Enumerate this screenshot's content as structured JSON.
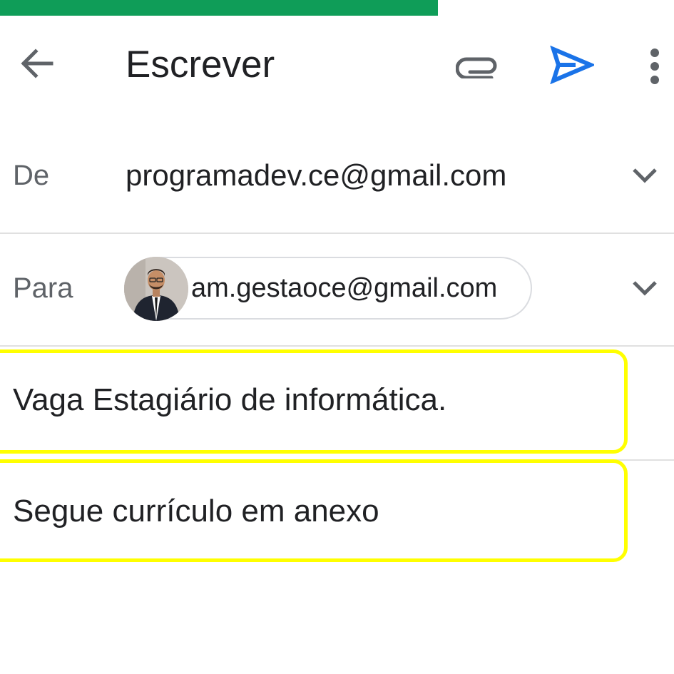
{
  "progress": {
    "fraction": 0.65,
    "color": "#0f9d58"
  },
  "appbar": {
    "title": "Escrever",
    "icons": {
      "back": "arrow-back-icon",
      "attach": "paperclip-icon",
      "send": "send-icon",
      "more": "more-vert-icon"
    },
    "send_color": "#1a73e8"
  },
  "from": {
    "label": "De",
    "value": "programadev.ce@gmail.com"
  },
  "to": {
    "label": "Para",
    "recipient": "am.gestaoce@gmail.com"
  },
  "subject": {
    "value": "Vaga Estagiário de informática."
  },
  "body": {
    "value": "Segue currículo em anexo"
  },
  "colors": {
    "highlight": "#ffff00",
    "divider": "#e0e0e0",
    "label": "#5f6368"
  }
}
